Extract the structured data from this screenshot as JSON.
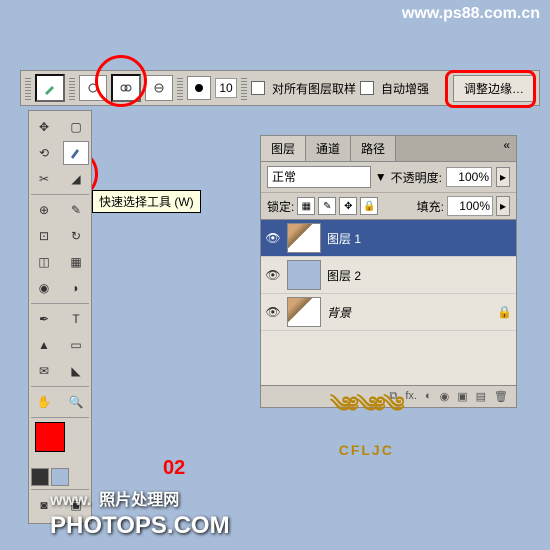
{
  "urls": {
    "top": "www.ps88.com.cn"
  },
  "optbar": {
    "brush_size": "10",
    "sample_all": "对所有图层取样",
    "auto_enhance": "自动增强",
    "refine_edge": "调整边缘…"
  },
  "tooltip": "快速选择工具 (W)",
  "panel": {
    "tabs": [
      "图层",
      "通道",
      "路径"
    ],
    "blend_mode": "正常",
    "opacity_label": "不透明度:",
    "opacity_value": "100%",
    "lock_label": "锁定:",
    "fill_label": "填充:",
    "fill_value": "100%",
    "layers": [
      {
        "name": "图层 1",
        "selected": true,
        "thumb": "img"
      },
      {
        "name": "图层 2",
        "selected": false,
        "thumb": "blue"
      },
      {
        "name": "背景",
        "selected": false,
        "thumb": "img",
        "locked": true
      }
    ]
  },
  "logo_text": "CFLJC",
  "step_number": "02",
  "footer": {
    "prefix": "www.",
    "cn": "照片处理网",
    "main": "PHOTOPS.COM"
  }
}
